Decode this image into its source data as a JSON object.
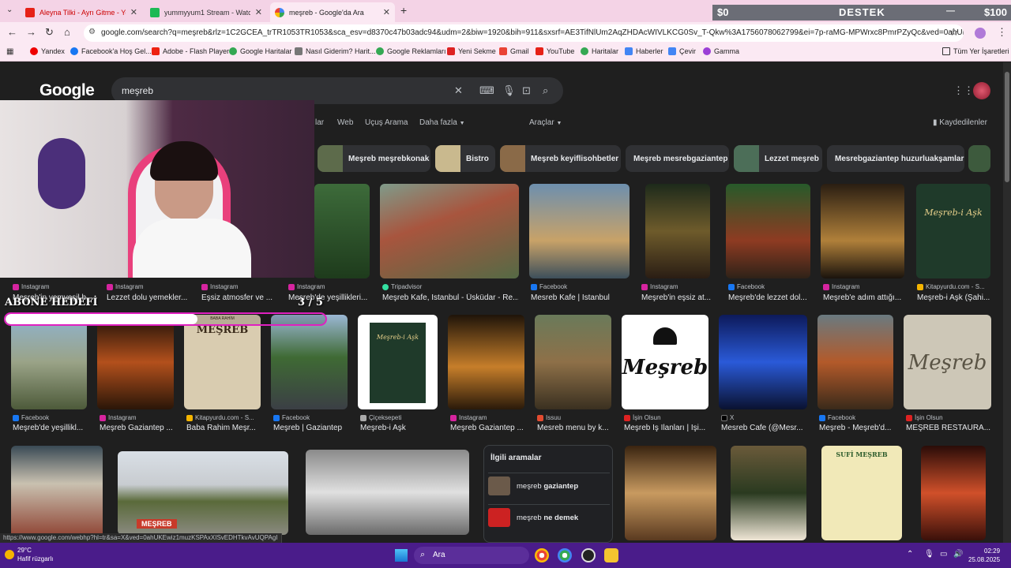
{
  "browser": {
    "tabs": [
      {
        "label": "Aleyna Tilki - Ayrı Gitme - YouTube",
        "active": false
      },
      {
        "label": "yummyyum1 Stream - Watch Live",
        "active": false
      },
      {
        "label": "meşreb - Google'da Ara",
        "active": true
      }
    ],
    "new_tab": "+",
    "url": "google.com/search?q=meşreb&rlz=1C2GCEA_trTR1053TR1053&sca_esv=d8370c47b03adc94&udm=2&biw=1920&bih=911&sxsrf=AE3TifNlUm2AqZHDAcWIVLKCG0Sv_T-Qkw%3A1756078062799&ei=7p-raMG-MPWrxc8PmrPZyQc&ved=0ahUKEwjB7YXJzKS...",
    "bookmarks": [
      "Yandex",
      "Facebook'a Hoş Gel...",
      "Adobe - Flash Player",
      "Google Haritalar",
      "Nasıl Giderim? Harit...",
      "Google Reklamları",
      "Yeni Sekme",
      "Gmail",
      "YouTube",
      "Haritalar",
      "Haberler",
      "Çevir",
      "Gamma"
    ],
    "all_bookmarks": "Tüm Yer İşaretleri",
    "status_url": "https://www.google.com/webhp?hl=tr&sa=X&ved=0ahUKEwiz1muzKSPAxXISvEDHTkvAvUQPAgI"
  },
  "stream_overlay": {
    "left_amount": "$0",
    "label": "DESTEK",
    "right_amount": "$100",
    "goal_label": "ABONE HEDEFİ",
    "goal_count": "3 / 5",
    "goal_progress": 0.6
  },
  "google": {
    "logo": "Google",
    "query": "meşreb",
    "nav_tabs": [
      "lar",
      "Web",
      "Uçuş Arama",
      "Daha fazla"
    ],
    "tools": "Araçlar",
    "saved": "Kaydedilenler",
    "chips": [
      "Meşreb meşrebkonak",
      "Bistro",
      "Meşreb keyiflisohbetler",
      "Meşreb mesrebgaziantep",
      "Lezzet meşreb",
      "Mesrebgaziantep huzurluakşamlar"
    ],
    "row1": [
      {
        "source": "Instagram",
        "title": "Meşreb'in yemyeşil b..."
      },
      {
        "source": "Instagram",
        "title": "Lezzet dolu yemekler..."
      },
      {
        "source": "Instagram",
        "title": "Eşsiz atmosfer ve ..."
      },
      {
        "source": "Instagram",
        "title": "Meşreb'de yeşillikleri..."
      },
      {
        "source": "Tripadvisor",
        "title": "Meşreb Kafe, İstanbul - Üsküdar - Re..."
      },
      {
        "source": "Facebook",
        "title": "Mesreb Kafe | Istanbul"
      },
      {
        "source": "Instagram",
        "title": "Meşreb'in eşsiz at..."
      },
      {
        "source": "Facebook",
        "title": "Meşreb'de lezzet dol..."
      },
      {
        "source": "Instagram",
        "title": "Meşreb'e adım attığı..."
      },
      {
        "source": "Kitapyurdu.com - S...",
        "title": "Meşreb-i Aşk (Şahi..."
      }
    ],
    "row2": [
      {
        "source": "Facebook",
        "title": "Meşreb'de yeşillikl..."
      },
      {
        "source": "Instagram",
        "title": "Meşreb Gaziantep ..."
      },
      {
        "source": "Kitapyurdu.com - S...",
        "title": "Baba Rahim Meşr..."
      },
      {
        "source": "Facebook",
        "title": "Meşreb | Gaziantep"
      },
      {
        "source": "Çiçeksepeti",
        "title": "Meşreb-i Aşk"
      },
      {
        "source": "Instagram",
        "title": "Meşreb Gaziantep ..."
      },
      {
        "source": "Issuu",
        "title": "Mesreb menu by k..."
      },
      {
        "source": "İşin Olsun",
        "title": "Meşreb İş İlanları | İşi..."
      },
      {
        "source": "X",
        "title": "Mesreb Cafe (@Mesr..."
      },
      {
        "source": "Facebook",
        "title": "Meşreb - Meşreb'd..."
      },
      {
        "source": "İşin Olsun",
        "title": "MEŞREB RESTAURA..."
      }
    ],
    "thumb_texts": {
      "book": "MEŞREB",
      "book_author": "BABA RAHİM",
      "logo": "Meşreb",
      "poster": "SUFİ MEŞREB",
      "sign": "MEŞREB",
      "ask_title": "Meşreb-i Aşk"
    },
    "related": {
      "title": "İlgili aramalar",
      "items": [
        {
          "base": "meşreb",
          "bold": "gaziantep"
        },
        {
          "base": "meşreb",
          "bold": "ne demek"
        }
      ]
    }
  },
  "taskbar": {
    "temp": "29°C",
    "weather_desc": "Hafif rüzgarlı",
    "search": "Ara",
    "time": "02:29",
    "date": "25.08.2025"
  },
  "colors": {
    "accent": "#e020c0",
    "taskbar": "#4a1c8a",
    "tabbar": "#f4d3e6"
  }
}
